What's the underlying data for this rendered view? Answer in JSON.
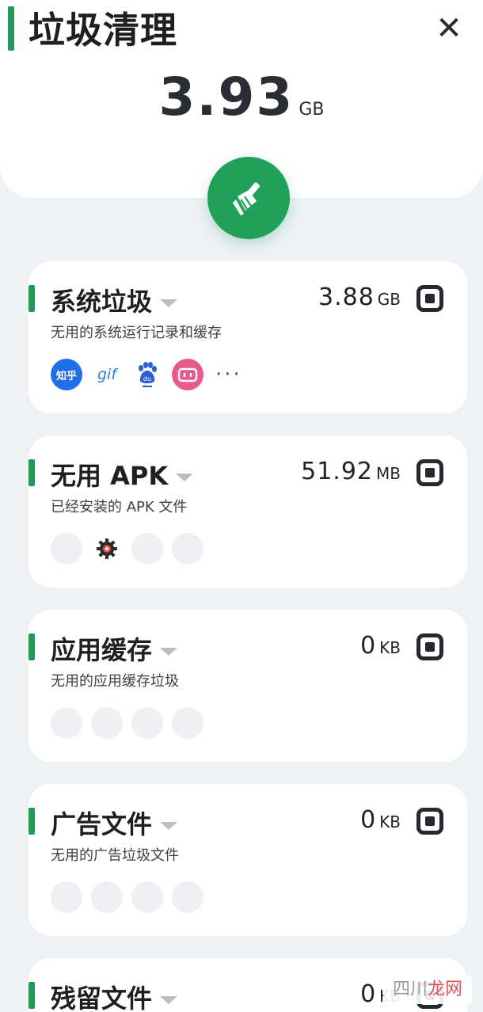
{
  "header": {
    "title": "垃圾清理",
    "close_label": "✕",
    "total_value": "3.93",
    "total_unit": "GB"
  },
  "categories": [
    {
      "title": "系统垃圾",
      "size": "3.88",
      "unit": "GB",
      "desc": "无用的系统运行记录和缓存",
      "icons": [
        "zhihu-icon",
        "gif-icon",
        "baidu-icon",
        "bilibili-icon"
      ],
      "icon_labels": {
        "zhihu": "知乎",
        "gif": "gif"
      },
      "more": "···"
    },
    {
      "title": "无用 APK",
      "size": "51.92",
      "unit": "MB",
      "desc": "已经安装的 APK 文件",
      "icons": [
        "placeholder-icon",
        "settings-icon",
        "placeholder-icon",
        "placeholder-icon"
      ]
    },
    {
      "title": "应用缓存",
      "size": "0",
      "unit": "KB",
      "desc": "无用的应用缓存垃圾",
      "icons": [
        "placeholder-icon",
        "placeholder-icon",
        "placeholder-icon",
        "placeholder-icon"
      ]
    },
    {
      "title": "广告文件",
      "size": "0",
      "unit": "KB",
      "desc": "无用的广告垃圾文件",
      "icons": [
        "placeholder-icon",
        "placeholder-icon",
        "placeholder-icon",
        "placeholder-icon"
      ]
    },
    {
      "title": "残留文件",
      "size": "0",
      "unit": "KB"
    }
  ],
  "watermark": {
    "left": "四川",
    "right": "龙网"
  },
  "colors": {
    "accent": "#1f9b57",
    "clean_button": "#21a05a",
    "background": "#eef1f6"
  }
}
